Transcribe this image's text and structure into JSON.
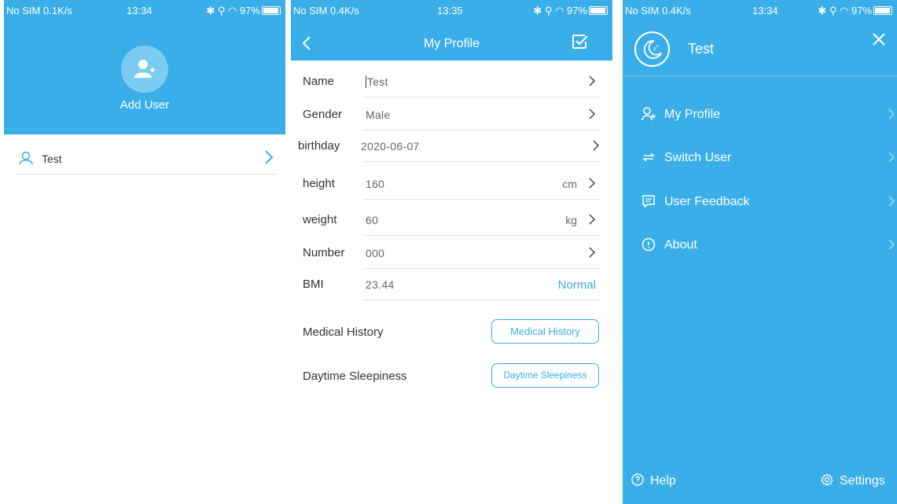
{
  "colors": {
    "accent": "#3aaee8",
    "divider": "#e3e3e3",
    "text": "#333333"
  },
  "screen1": {
    "status": {
      "left": "No SIM 0.1K/s",
      "time": "13:34",
      "battery": "97%"
    },
    "add_user_label": "Add User",
    "users": [
      {
        "name": "Test",
        "icon": "user-icon"
      }
    ]
  },
  "screen2": {
    "status": {
      "left": "No SIM 0.4K/s",
      "time": "13:35",
      "battery": "97%"
    },
    "title": "My Profile",
    "fields": {
      "name": {
        "label": "Name",
        "value": "Test"
      },
      "gender": {
        "label": "Gender",
        "value": "Male"
      },
      "birthday": {
        "label": "birthday",
        "value": "2020-06-07"
      },
      "height": {
        "label": "height",
        "value": "160",
        "unit": "cm"
      },
      "weight": {
        "label": "weight",
        "value": "60",
        "unit": "kg"
      },
      "number": {
        "label": "Number",
        "value": "000"
      },
      "bmi": {
        "label": "BMI",
        "value": "23.44",
        "status": "Normal"
      }
    },
    "medical_history": {
      "label": "Medical History",
      "button": "Medical History"
    },
    "daytime_sleepiness": {
      "label": "Daytime Sleepiness",
      "button": "Daytime Sleepiness"
    }
  },
  "screen3": {
    "status": {
      "left": "No SIM 0.4K/s",
      "time": "13:34",
      "battery": "97%"
    },
    "user_name": "Test",
    "menu": [
      {
        "label": "My Profile",
        "icon": "add-user-icon"
      },
      {
        "label": "Switch User",
        "icon": "switch-icon"
      },
      {
        "label": "User Feedback",
        "icon": "feedback-icon"
      },
      {
        "label": "About",
        "icon": "info-icon"
      }
    ],
    "help_label": "Help",
    "settings_label": "Settings"
  }
}
